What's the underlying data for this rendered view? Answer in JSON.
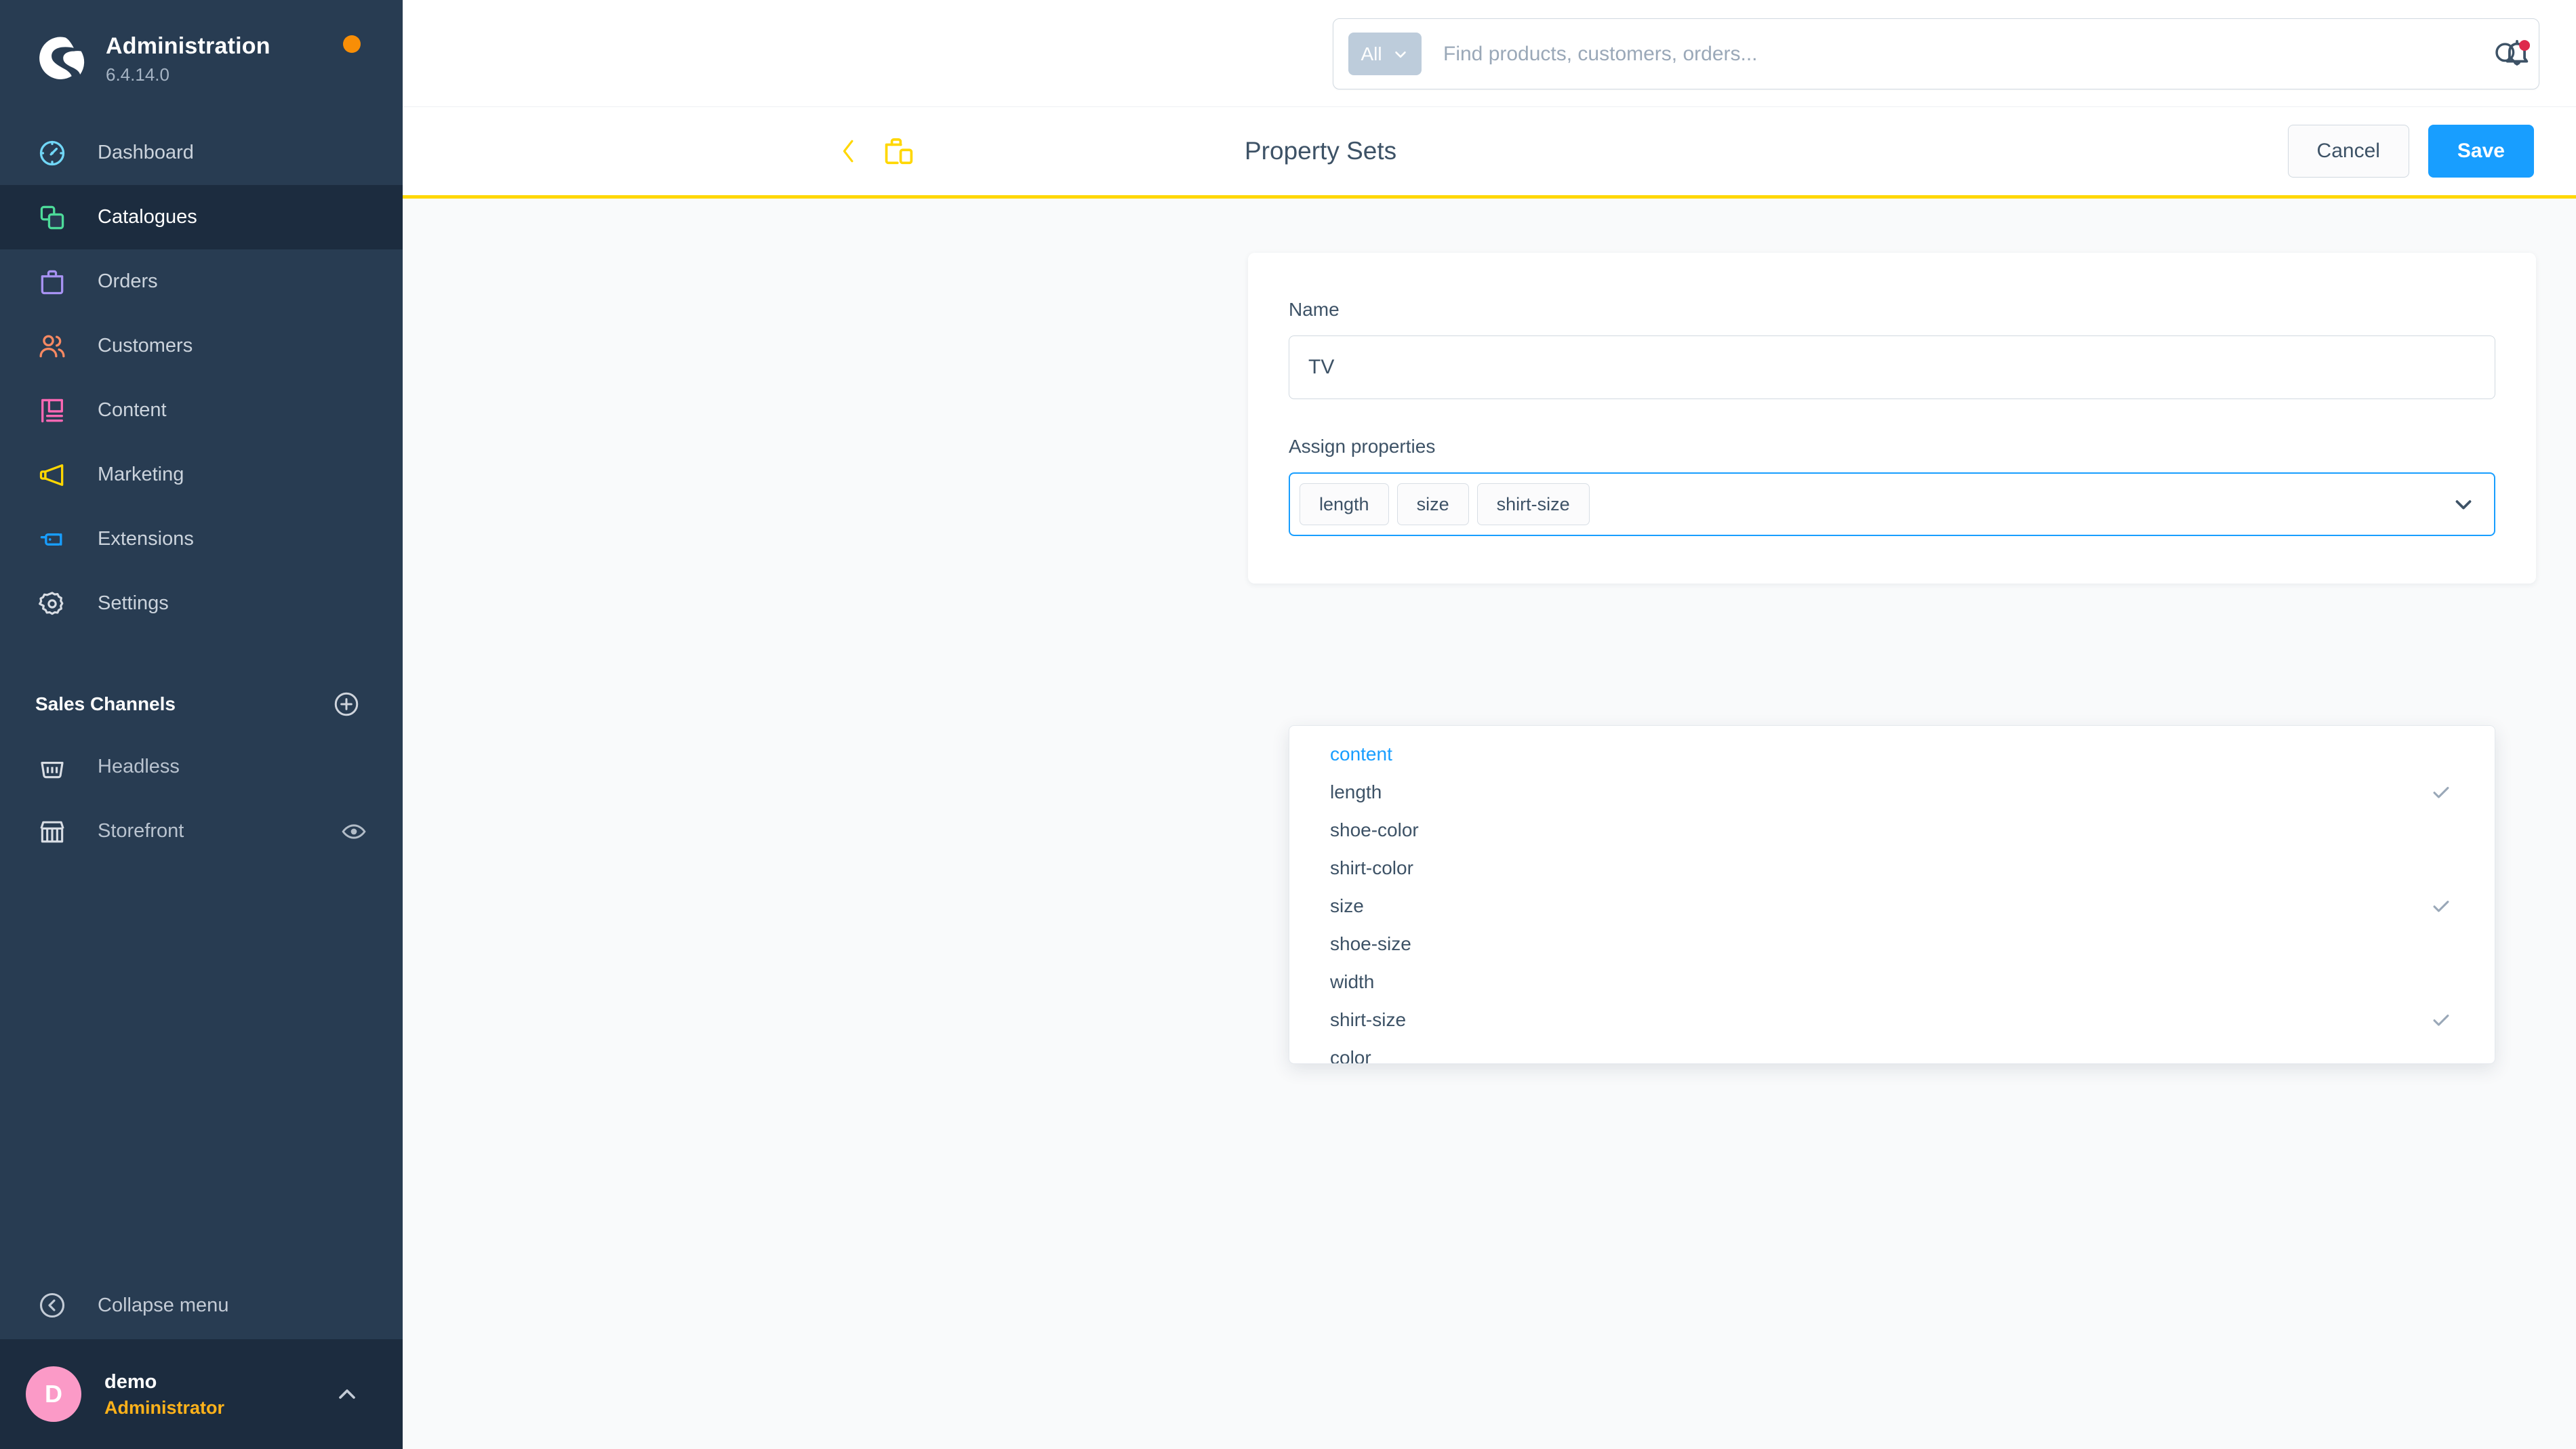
{
  "sidebar": {
    "title": "Administration",
    "version": "6.4.14.0",
    "update_dot": "update-available-dot",
    "nav": [
      {
        "label": "Dashboard",
        "icon": "dashboard-icon",
        "color": "#71d7f7",
        "active": false
      },
      {
        "label": "Catalogues",
        "icon": "catalogues-icon",
        "color": "#4ddb9a",
        "active": true
      },
      {
        "label": "Orders",
        "icon": "orders-icon",
        "color": "#a792f2",
        "active": false
      },
      {
        "label": "Customers",
        "icon": "customers-icon",
        "color": "#f88962",
        "active": false
      },
      {
        "label": "Content",
        "icon": "content-icon",
        "color": "#ff68b4",
        "active": false
      },
      {
        "label": "Marketing",
        "icon": "marketing-icon",
        "color": "#ffd700",
        "active": false
      },
      {
        "label": "Extensions",
        "icon": "extensions-icon",
        "color": "#189eff",
        "active": false
      },
      {
        "label": "Settings",
        "icon": "settings-gear-icon",
        "color": "#d8dde4",
        "active": false
      }
    ],
    "sales_channels": {
      "title": "Sales Channels",
      "add_label": "add-sales-channel",
      "items": [
        {
          "label": "Headless",
          "icon": "basket-icon",
          "has_eye": false
        },
        {
          "label": "Storefront",
          "icon": "storefront-icon",
          "has_eye": true
        }
      ]
    },
    "collapse_label": "Collapse menu",
    "user": {
      "initial": "D",
      "name": "demo",
      "role": "Administrator"
    }
  },
  "topbar": {
    "search_scope": "All",
    "search_placeholder": "Find products, customers, orders...",
    "search_value": "",
    "notification_icon": "bell-icon",
    "has_notification": true
  },
  "smartbar": {
    "back_icon": "chevron-left-icon",
    "module_icon": "products-icon",
    "title": "Property Sets",
    "cancel_label": "Cancel",
    "save_label": "Save"
  },
  "form": {
    "name_label": "Name",
    "name_value": "TV",
    "name_placeholder": "",
    "assign_label": "Assign properties",
    "selected_tags": [
      "length",
      "size",
      "shirt-size"
    ]
  },
  "dropdown": {
    "options": [
      {
        "label": "content",
        "selected": false,
        "highlighted": true
      },
      {
        "label": "length",
        "selected": true,
        "highlighted": false
      },
      {
        "label": "shoe-color",
        "selected": false,
        "highlighted": false
      },
      {
        "label": "shirt-color",
        "selected": false,
        "highlighted": false
      },
      {
        "label": "size",
        "selected": true,
        "highlighted": false
      },
      {
        "label": "shoe-size",
        "selected": false,
        "highlighted": false
      },
      {
        "label": "width",
        "selected": false,
        "highlighted": false
      },
      {
        "label": "shirt-size",
        "selected": true,
        "highlighted": false
      },
      {
        "label": "color",
        "selected": false,
        "highlighted": false
      }
    ]
  },
  "colors": {
    "sidebar_bg": "#283c52",
    "sidebar_active": "#1c2c3f",
    "primary": "#189eff",
    "accent_yellow": "#ffd700",
    "role_orange": "#ffb21a",
    "avatar_pink": "#fb9ac7",
    "notification_red": "#de294c",
    "update_orange": "#f88e06"
  }
}
